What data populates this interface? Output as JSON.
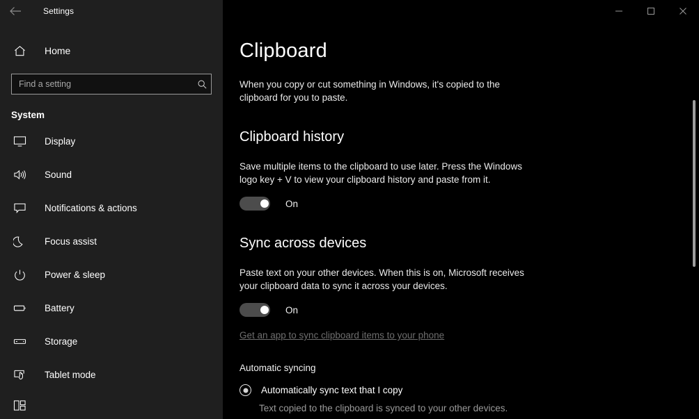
{
  "window": {
    "title": "Settings",
    "back_label": "Back",
    "minimize_label": "Minimize",
    "maximize_label": "Maximize",
    "close_label": "Close",
    "accent_color": "#1f6f9e",
    "sidebar_bg": "#1f1f1f",
    "content_bg": "#000000"
  },
  "sidebar": {
    "home_label": "Home",
    "search": {
      "placeholder": "Find a setting",
      "value": ""
    },
    "section_label": "System",
    "items": [
      {
        "label": "Display",
        "icon": "monitor-icon"
      },
      {
        "label": "Sound",
        "icon": "speaker-icon"
      },
      {
        "label": "Notifications & actions",
        "icon": "notification-icon"
      },
      {
        "label": "Focus assist",
        "icon": "moon-icon"
      },
      {
        "label": "Power & sleep",
        "icon": "power-icon"
      },
      {
        "label": "Battery",
        "icon": "battery-icon"
      },
      {
        "label": "Storage",
        "icon": "storage-icon"
      },
      {
        "label": "Tablet mode",
        "icon": "tablet-icon"
      }
    ]
  },
  "main": {
    "title": "Clipboard",
    "description": "When you copy or cut something in Windows, it's copied to the clipboard for you to paste.",
    "clipboard_history": {
      "heading": "Clipboard history",
      "description": "Save multiple items to the clipboard to use later. Press the Windows logo key + V to view your clipboard history and paste from it.",
      "toggle_state": "On"
    },
    "sync_across_devices": {
      "heading": "Sync across devices",
      "description": "Paste text on your other devices. When this is on, Microsoft receives your clipboard data to sync it across your devices.",
      "toggle_state": "On",
      "link_label": "Get an app to sync clipboard items to your phone"
    },
    "automatic_syncing": {
      "heading": "Automatic syncing",
      "option_label": "Automatically sync text that I copy",
      "option_description": "Text copied to the clipboard is synced to your other devices.",
      "selected": true
    }
  }
}
